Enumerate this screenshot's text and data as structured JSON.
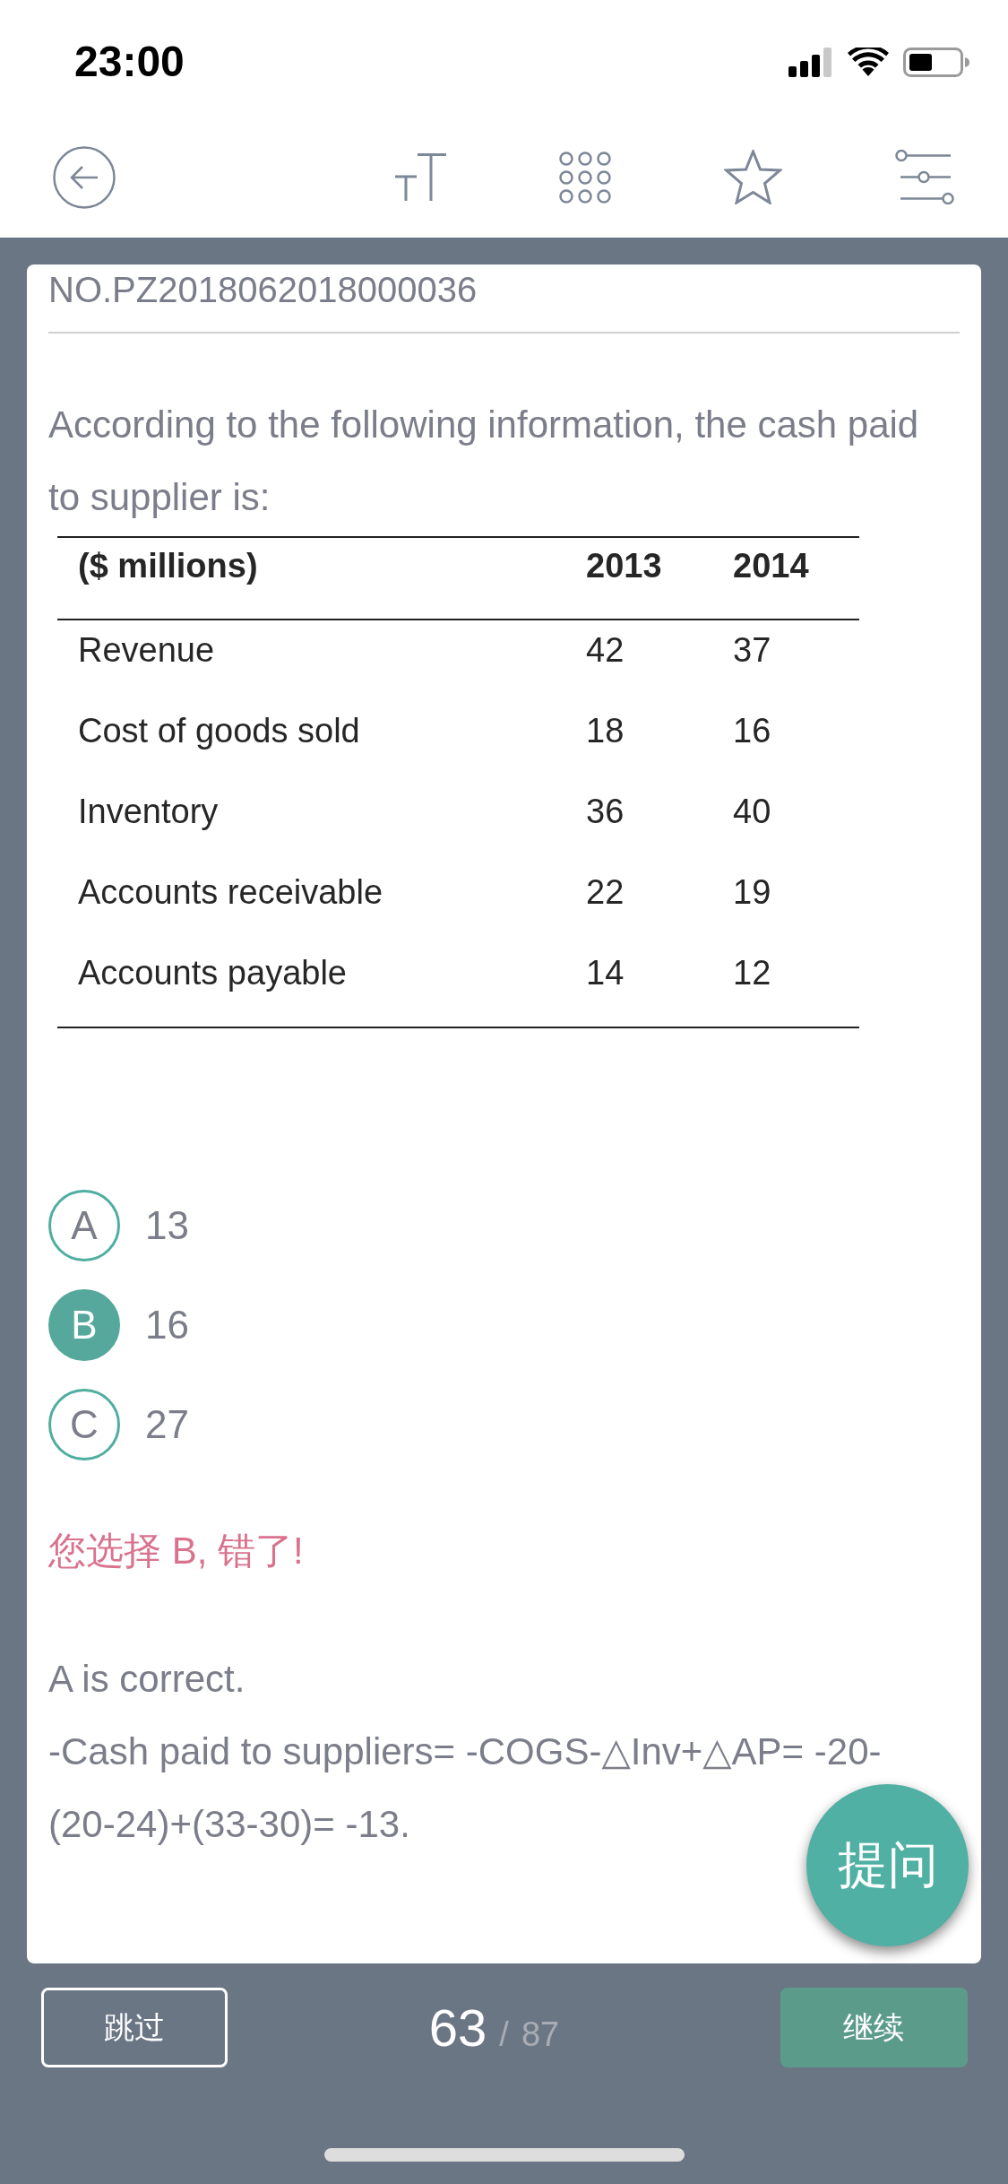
{
  "status_bar": {
    "time": "23:00"
  },
  "question": {
    "number": "NO.PZ2018062018000036",
    "text": "According to the following information, the cash paid to supplier is:",
    "table": {
      "columns": [
        "($ millions)",
        "2013",
        "2014"
      ],
      "rows": [
        [
          "Revenue",
          "42",
          "37"
        ],
        [
          "Cost of goods sold",
          "18",
          "16"
        ],
        [
          "Inventory",
          "36",
          "40"
        ],
        [
          "Accounts receivable",
          "22",
          "19"
        ],
        [
          "Accounts payable",
          "14",
          "12"
        ]
      ]
    }
  },
  "options": [
    {
      "letter": "A",
      "text": "13",
      "selected": false
    },
    {
      "letter": "B",
      "text": "16",
      "selected": true
    },
    {
      "letter": "C",
      "text": "27",
      "selected": false
    }
  ],
  "result": "您选择 B, 错了!",
  "explanation": [
    "A is correct.",
    "-Cash paid to suppliers= -COGS-△Inv+△AP= -20-(20-24)+(33-30)= -13."
  ],
  "ask_button": "提问",
  "footer": {
    "skip": "跳过",
    "current": "63",
    "separator": "/",
    "total": "87",
    "continue": "继续"
  }
}
